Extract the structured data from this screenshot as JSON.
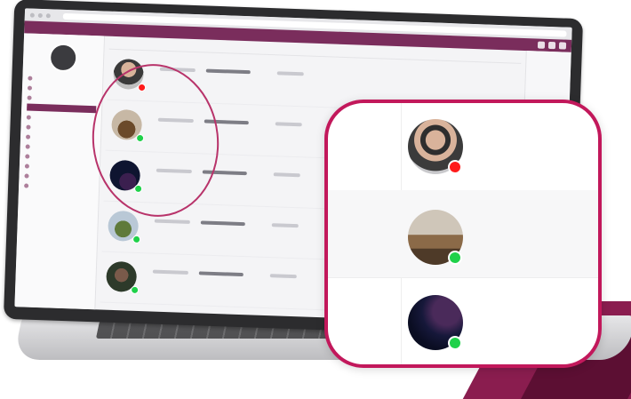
{
  "app": {
    "brand": "",
    "page_title": "",
    "columns": [
      "",
      "",
      "",
      "",
      "",
      ""
    ]
  },
  "sidebar": {
    "user_name": ""
  },
  "laptop": {
    "model_label": ""
  },
  "zoom_rows": [
    {
      "name_line1": "",
      "name_line2": "",
      "email": "",
      "status": "busy",
      "status_color": "#ff1a1a"
    },
    {
      "name_line1": "",
      "name_line2": "",
      "email": "",
      "status": "online",
      "status_color": "#1fd14a"
    },
    {
      "name_line1": "",
      "name_line2": "",
      "email": "",
      "status": "online",
      "status_color": "#1fd14a"
    }
  ],
  "colors": {
    "accent": "#7a2d5c",
    "callout_border": "#c2185b",
    "ribbon": "#8a1d4f"
  }
}
